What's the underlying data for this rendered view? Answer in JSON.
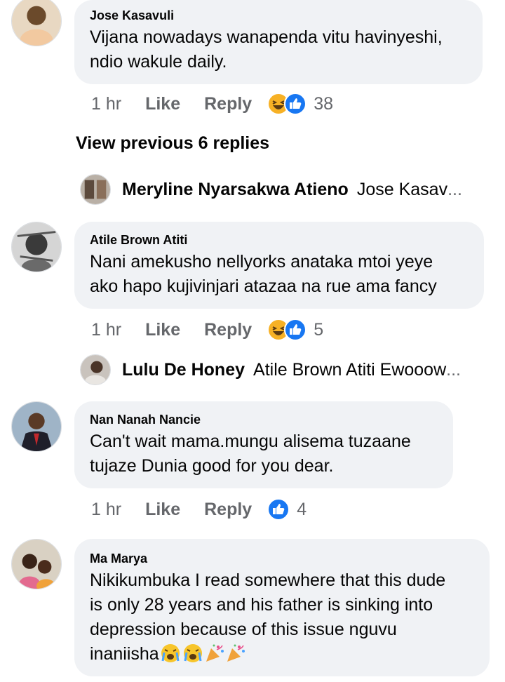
{
  "comments": [
    {
      "author": "Jose Kasavuli",
      "lines": [
        "Vijana nowadays wanapenda vitu havinyeshi,",
        "ndio wakule daily."
      ],
      "time": "1 hr",
      "like": "Like",
      "reply": "Reply",
      "reactions": [
        "haha-icon",
        "like-icon"
      ],
      "reaction_count": "38"
    },
    {
      "author": "Atile Brown Atiti",
      "lines": [
        "Nani amekusho nellyorks anataka mtoi yeye",
        "ako hapo kujivinjari atazaa na rue ama fancy"
      ],
      "time": "1 hr",
      "like": "Like",
      "reply": "Reply",
      "reactions": [
        "haha-icon",
        "like-icon"
      ],
      "reaction_count": "5"
    },
    {
      "author": "Nan Nanah Nancie",
      "lines": [
        "Can't wait mama.mungu alisema tuzaane",
        "tujaze Dunia good for you dear."
      ],
      "time": "1 hr",
      "like": "Like",
      "reply": "Reply",
      "reactions": [
        "like-icon"
      ],
      "reaction_count": "4"
    },
    {
      "author": "Ma Marya",
      "lines": [
        "Nikikumbuka I read somewhere that this dude",
        "is only 28 years and his father is sinking into",
        "depression because of this issue nguvu",
        "inaniisha"
      ],
      "emojis": [
        "crying-face-icon",
        "crying-face-icon",
        "party-popper-icon",
        "party-popper-icon"
      ]
    }
  ],
  "view_previous": "View previous 6 replies",
  "replies": [
    {
      "name": "Meryline Nyarsakwa Atieno",
      "preview": "Jose Kasav",
      "ellipsis": "..."
    },
    {
      "name": "Lulu De Honey",
      "preview": "Atile Brown Atiti Ewooow",
      "ellipsis": "..."
    }
  ],
  "colors": {
    "bubble": "#f0f2f5",
    "like_blue": "#1877f2",
    "haha_yellow": "#f7b125",
    "meta_gray": "#65676b"
  }
}
